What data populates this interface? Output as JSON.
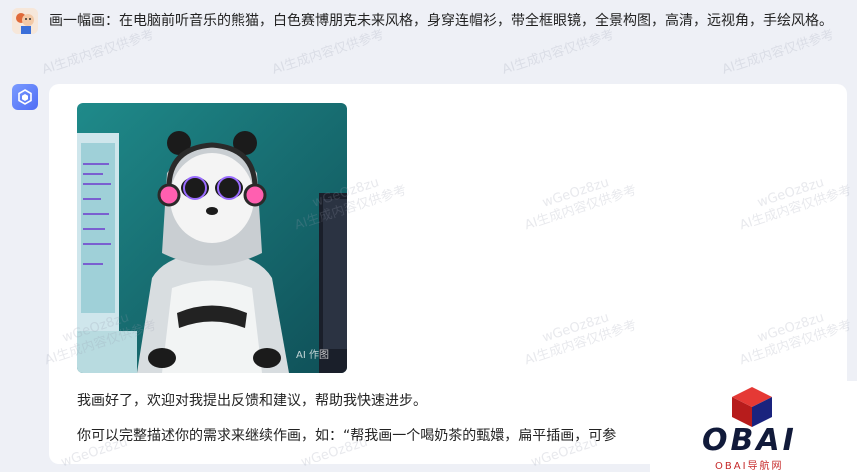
{
  "user_message": {
    "text": "画一幅画：在电脑前听音乐的熊猫，白色赛博朋克未来风格，身穿连帽衫，带全框眼镜，全景构图，高清，远视角，手绘风格。"
  },
  "bot_message": {
    "image_tag": "AI 作图",
    "reply_line1": "我画好了，欢迎对我提出反馈和建议，帮助我快速进步。",
    "reply_line2": "你可以完整描述你的需求来继续作画，如：“帮我画一个喝奶茶的甄嬛，扁平插画，可参"
  },
  "watermark": {
    "id": "wGeOz8zu",
    "notice": "AI生成内容仅供参考"
  },
  "logo": {
    "name": "OBAI",
    "subtitle": "OBAI导航网"
  },
  "colors": {
    "page_bg": "#eef0f6",
    "bubble_bg": "#ffffff",
    "bot_avatar": "#5b78f6",
    "logo_red": "#c62828",
    "logo_navy": "#111a3a"
  },
  "icons": {
    "user_avatar": "panda-avatar-icon",
    "bot_avatar": "assistant-cube-icon",
    "logo_mark": "cube-logo-icon"
  }
}
